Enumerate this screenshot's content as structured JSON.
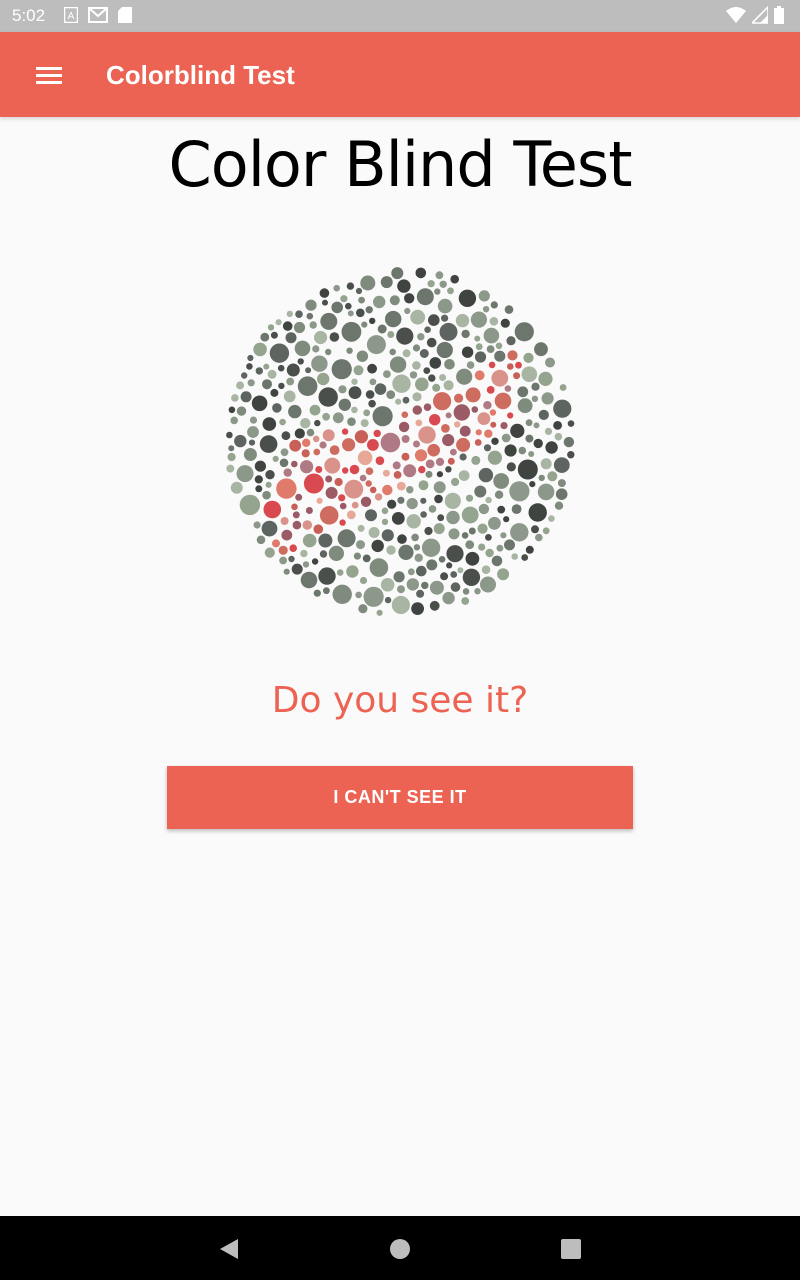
{
  "status_bar": {
    "time": "5:02",
    "left_icons": [
      "a-notification-icon",
      "gmail-icon",
      "sd-card-icon"
    ],
    "right_icons": [
      "wifi-icon",
      "signal-icon",
      "battery-icon"
    ]
  },
  "app_bar": {
    "title": "Colorblind Test",
    "menu_icon": "menu-icon",
    "color": "#ec6353"
  },
  "main": {
    "page_title": "Color Blind Test",
    "plate_icon": "ishihara-plate-image",
    "question": "Do you see it?",
    "cant_see_button": "I CAN'T SEE IT"
  },
  "nav_bar": {
    "icons": [
      "back-icon",
      "home-icon",
      "recents-icon"
    ]
  },
  "colors": {
    "accent": "#ec6353",
    "background": "#fafafa",
    "status_bar": "#bdbdbd"
  }
}
